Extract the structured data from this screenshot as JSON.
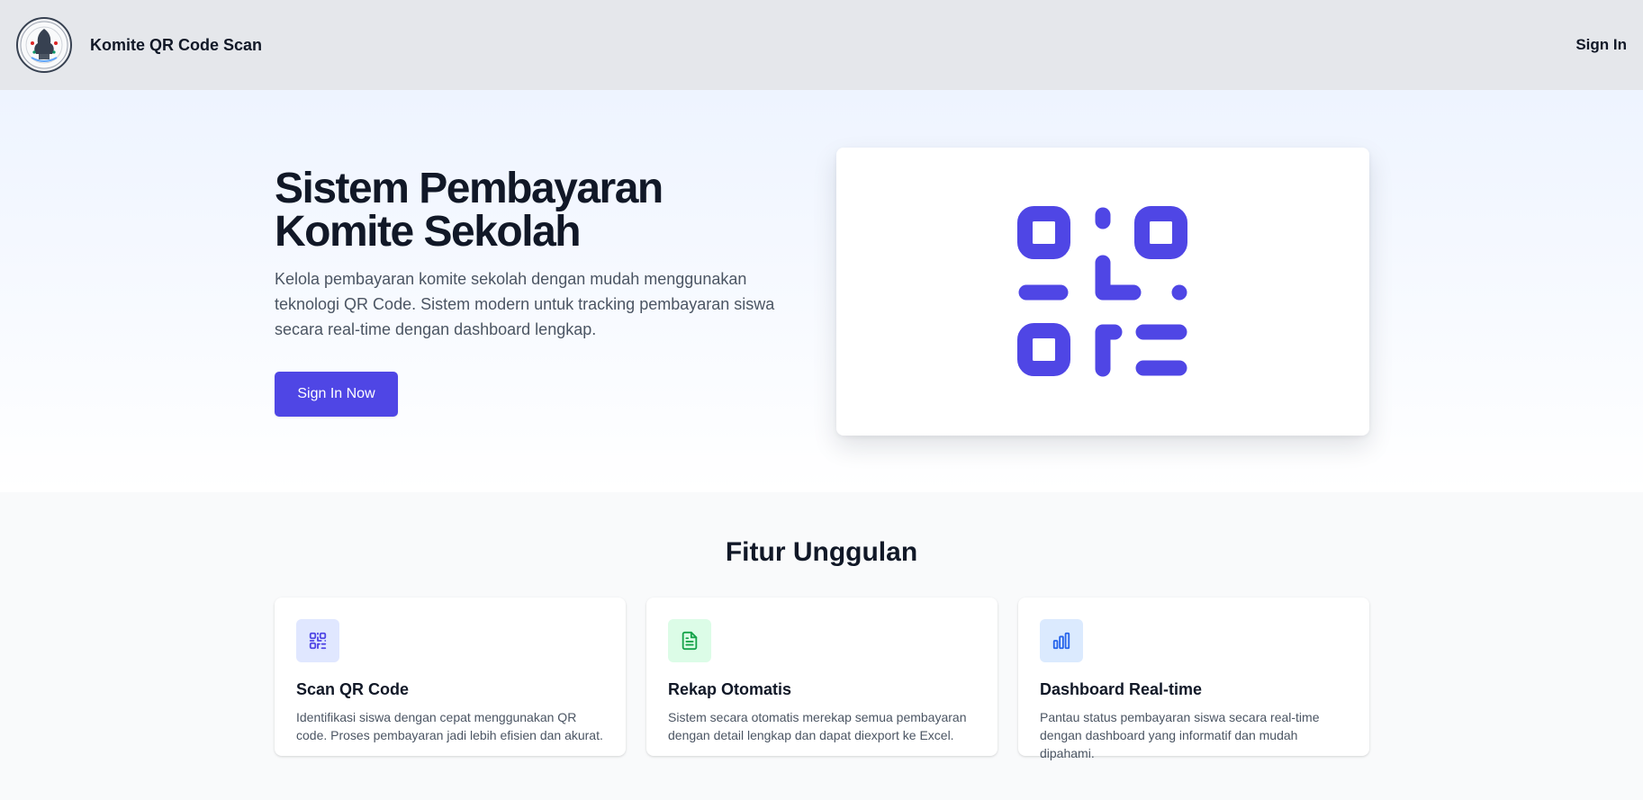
{
  "header": {
    "app_title": "Komite QR Code Scan",
    "sign_in_label": "Sign In",
    "logo_icon": "school-emblem-logo"
  },
  "hero": {
    "title_line1": "Sistem Pembayaran",
    "title_line2": "Komite Sekolah",
    "description": "Kelola pembayaran komite sekolah dengan mudah menggunakan teknologi QR Code. Sistem modern untuk tracking pembayaran siswa secara real-time dengan dashboard lengkap.",
    "cta_label": "Sign In Now",
    "illustration_icon": "qr-code-icon"
  },
  "features": {
    "section_title": "Fitur Unggulan",
    "items": [
      {
        "icon": "qr-scan-icon",
        "title": "Scan QR Code",
        "description": "Identifikasi siswa dengan cepat menggunakan QR code. Proses pembayaran jadi lebih efisien dan akurat."
      },
      {
        "icon": "document-icon",
        "title": "Rekap Otomatis",
        "description": "Sistem secara otomatis merekap semua pembayaran dengan detail lengkap dan dapat diexport ke Excel."
      },
      {
        "icon": "bar-chart-icon",
        "title": "Dashboard Real-time",
        "description": "Pantau status pembayaran siswa secara real-time dengan dashboard yang informatif dan mudah dipahami."
      }
    ]
  },
  "colors": {
    "accent": "#4f46e5",
    "header_bg": "#e5e7eb",
    "feature_icon_bg_1": "#e0e7ff",
    "feature_icon_bg_2": "#dcfce7",
    "feature_icon_bg_3": "#dbeafe"
  }
}
